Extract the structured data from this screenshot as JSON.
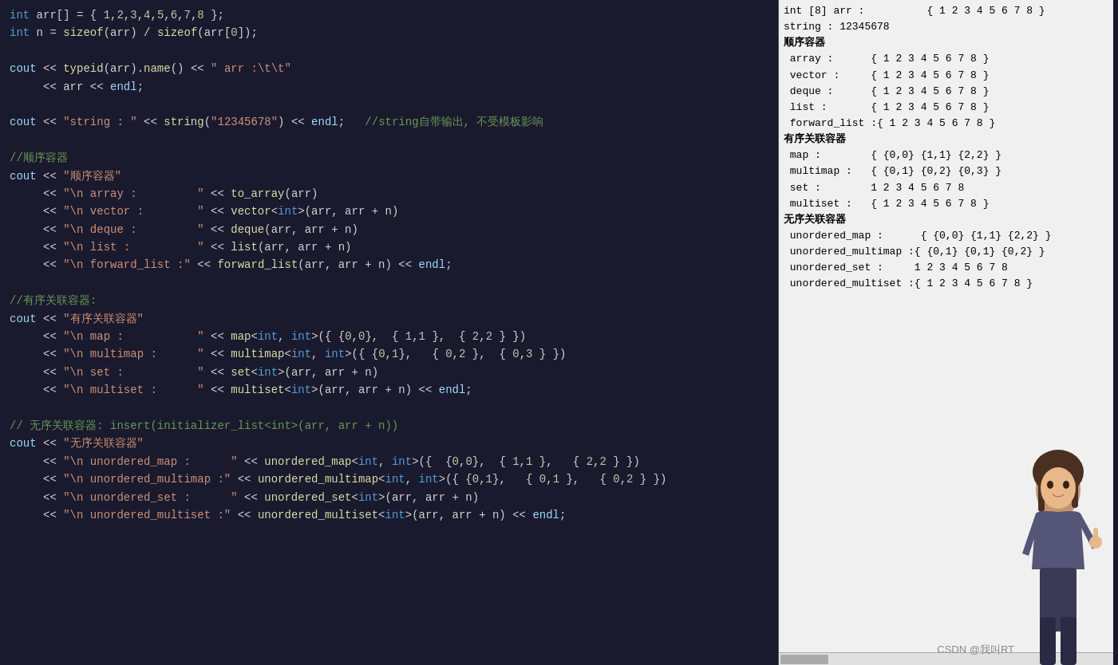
{
  "left_panel": {
    "lines": [
      {
        "id": "l1",
        "content": "int arr[] = { 1,2,3,4,5,6,7,8 };"
      },
      {
        "id": "l2",
        "content": "int n = sizeof(arr) / sizeof(arr[0]);"
      },
      {
        "id": "l3",
        "content": ""
      },
      {
        "id": "l4",
        "content": "cout << typeid(arr).name() << \" arr :\\t\\t\""
      },
      {
        "id": "l5",
        "content": "     << arr << endl;"
      },
      {
        "id": "l6",
        "content": ""
      },
      {
        "id": "l7",
        "content": "cout << \"string : \" << string(\"12345678\") << endl;   //string自带输出, 不受模板影响"
      },
      {
        "id": "l8",
        "content": ""
      },
      {
        "id": "l9",
        "content": "//顺序容器"
      },
      {
        "id": "l10",
        "content": "cout << \"顺序容器\""
      },
      {
        "id": "l11",
        "content": "     << \"\\n array :         \" << to_array(arr)"
      },
      {
        "id": "l12",
        "content": "     << \"\\n vector :        \" << vector<int>(arr, arr + n)"
      },
      {
        "id": "l13",
        "content": "     << \"\\n deque :         \" << deque(arr, arr + n)"
      },
      {
        "id": "l14",
        "content": "     << \"\\n list :          \" << list(arr, arr + n)"
      },
      {
        "id": "l15",
        "content": "     << \"\\n forward_list :\" << forward_list(arr, arr + n) << endl;"
      },
      {
        "id": "l16",
        "content": ""
      },
      {
        "id": "l17",
        "content": "//有序关联容器:"
      },
      {
        "id": "l18",
        "content": "cout << \"有序关联容器\""
      },
      {
        "id": "l19",
        "content": "     << \"\\n map :           \" << map<int, int>({ {0,0},  { 1,1 },  { 2,2 } })"
      },
      {
        "id": "l20",
        "content": "     << \"\\n multimap :      \" << multimap<int, int>({ {0,1},   { 0,2 },  { 0,3 } })"
      },
      {
        "id": "l21",
        "content": "     << \"\\n set :           \" << set<int>(arr, arr + n)"
      },
      {
        "id": "l22",
        "content": "     << \"\\n multiset :      \" << multiset<int>(arr, arr + n) << endl;"
      },
      {
        "id": "l23",
        "content": ""
      },
      {
        "id": "l24",
        "content": "// 无序关联容器: insert(initializer_list<int>(arr, arr + n))"
      },
      {
        "id": "l25",
        "content": "cout << \"无序关联容器\""
      },
      {
        "id": "l26",
        "content": "     << \"\\n unordered_map :      \" << unordered_map<int, int>({  {0,0},  { 1,1 },   { 2,2 } })"
      },
      {
        "id": "l27",
        "content": "     << \"\\n unordered_multimap :\" << unordered_multimap<int, int>({ {0,1},   { 0,1 },   { 0,2 } })"
      },
      {
        "id": "l28",
        "content": "     << \"\\n unordered_set :      \" << unordered_set<int>(arr, arr + n)"
      },
      {
        "id": "l29",
        "content": "     << \"\\n unordered_multiset :\" << unordered_multiset<int>(arr, arr + n) << endl;"
      }
    ]
  },
  "right_panel": {
    "lines": [
      "int [8] arr :          { 1 2 3 4 5 6 7 8 }",
      "string : 12345678",
      "顺序容器",
      " array :      { 1 2 3 4 5 6 7 8 }",
      " vector :     { 1 2 3 4 5 6 7 8 }",
      " deque :      { 1 2 3 4 5 6 7 8 }",
      " list :       { 1 2 3 4 5 6 7 8 }",
      " forward_list :{ 1 2 3 4 5 6 7 8 }",
      "有序关联容器",
      " map :        { {0,0} {1,1} {2,2} }",
      " multimap :   { {0,1} {0,2} {0,3} }",
      " set :        1 2 3 4 5 6 7 8",
      " multiset :   { 1 2 3 4 5 6 7 8 }",
      "无序关联容器",
      " unordered_map :      { {0,0} {1,1} {2,2} }",
      " unordered_multimap :{ {0,1} {0,1} {0,2} }",
      " unordered_set :     1 2 3 4 5 6 7 8",
      " unordered_multiset :{ 1 2 3 4 5 6 7 8 }"
    ],
    "bold_lines": [
      2,
      8,
      13
    ],
    "watermark": "CSDN @我叫RT"
  }
}
